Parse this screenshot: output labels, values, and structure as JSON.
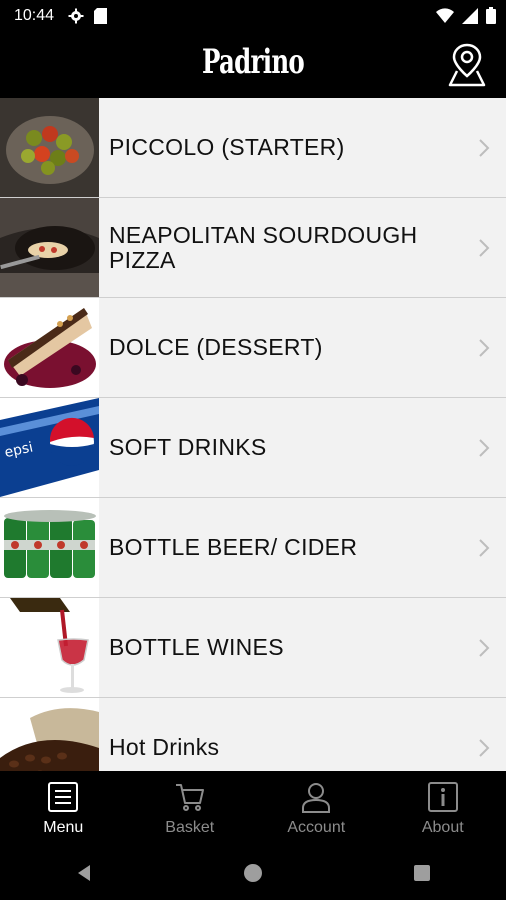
{
  "status_bar": {
    "time": "10:44"
  },
  "header": {
    "brand": "Padrino"
  },
  "menu": {
    "items": [
      {
        "label": "PICCOLO (STARTER)",
        "image": "olives-thumbnail"
      },
      {
        "label": "NEAPOLITAN SOURDOUGH PIZZA",
        "image": "pizza-oven-thumbnail"
      },
      {
        "label": "DOLCE (DESSERT)",
        "image": "cheesecake-thumbnail"
      },
      {
        "label": "SOFT DRINKS",
        "image": "pepsi-can-thumbnail"
      },
      {
        "label": "BOTTLE BEER/ CIDER",
        "image": "beer-cans-thumbnail"
      },
      {
        "label": "BOTTLE WINES",
        "image": "wine-pour-thumbnail"
      },
      {
        "label": "Hot Drinks",
        "image": "coffee-beans-thumbnail"
      }
    ]
  },
  "bottom_nav": {
    "active": "Menu",
    "items": [
      {
        "label": "Menu",
        "icon": "menu-list-icon"
      },
      {
        "label": "Basket",
        "icon": "cart-icon"
      },
      {
        "label": "Account",
        "icon": "person-icon"
      },
      {
        "label": "About",
        "icon": "info-icon"
      }
    ]
  },
  "colors": {
    "header_bg": "#000000",
    "list_bg": "#f2f2f2",
    "nav_active": "#ffffff",
    "nav_inactive": "#8c8c8c"
  }
}
